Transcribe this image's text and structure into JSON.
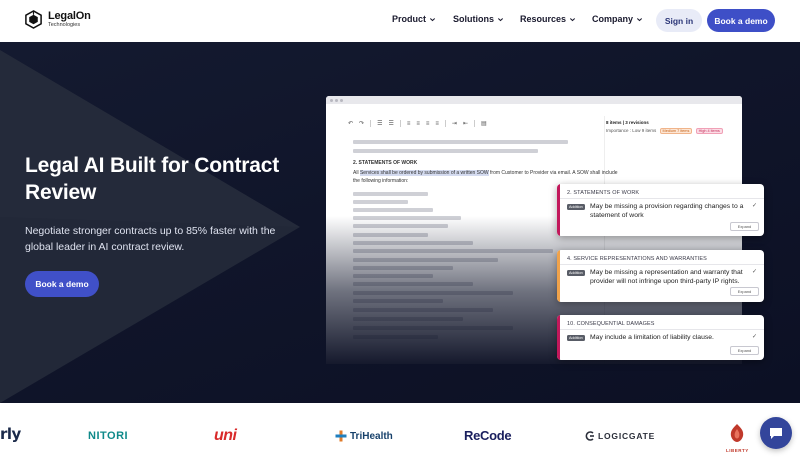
{
  "header": {
    "logo_name": "LegalOn",
    "logo_sub": "Technologies",
    "nav": [
      {
        "label": "Product"
      },
      {
        "label": "Solutions"
      },
      {
        "label": "Resources"
      },
      {
        "label": "Company"
      }
    ],
    "signin_label": "Sign in",
    "demo_label": "Book a demo"
  },
  "hero": {
    "title": "Legal AI Built for Contract Review",
    "subtitle": "Negotiate stronger contracts up to 85% faster with the global leader in AI contract review.",
    "cta_label": "Book a demo"
  },
  "mock": {
    "panel_counts": "8 items | 3 revisions",
    "panel_filter": "Importance : Low 9 items",
    "tag_medium": "Medium 7 items",
    "tag_high": "High 4 items",
    "doc_heading": "2.  STATEMENTS OF WORK",
    "doc_text_pre": "All ",
    "doc_text_hl": "Services shall be ordered by submission of a written SOW",
    "doc_text_post": " from Customer to Provider via email. A SOW shall include the following information:",
    "cards": [
      {
        "title": "2. STATEMENTS OF WORK",
        "badge": "Addition",
        "text": "May be missing a provision regarding changes to a statement of work",
        "expand": "Expand",
        "accent": "#c2185b"
      },
      {
        "title": "4. SERVICE REPRESENTATIONS AND WARRANTIES",
        "badge": "Addition",
        "text": "May be missing a representation and warranty that provider will not infringe upon third-party IP rights.",
        "expand": "Expand",
        "accent": "#f0a24a"
      },
      {
        "title": "10. CONSEQUENTIAL DAMAGES",
        "badge": "Addition",
        "text": "May include a limitation of liability clause.",
        "expand": "Expand",
        "accent": "#c2185b"
      }
    ]
  },
  "logos": [
    {
      "name": "rly",
      "color": "#1b2a4a"
    },
    {
      "name": "NITORI",
      "color": "#0f8a8a"
    },
    {
      "name": "uni",
      "color": "#d92a2a"
    },
    {
      "name": "TriHealth",
      "color": "#17416b"
    },
    {
      "name": "ReCode",
      "color": "#1a1f5e"
    },
    {
      "name": "LOGICGATE",
      "color": "#2b2f3a"
    },
    {
      "name": "LIBERTY",
      "color": "#c0392b"
    }
  ],
  "colors": {
    "brand_primary": "#3e4fc7",
    "hero_bg": "#141a30",
    "accent_high": "#c2185b",
    "accent_medium": "#f0a24a"
  }
}
